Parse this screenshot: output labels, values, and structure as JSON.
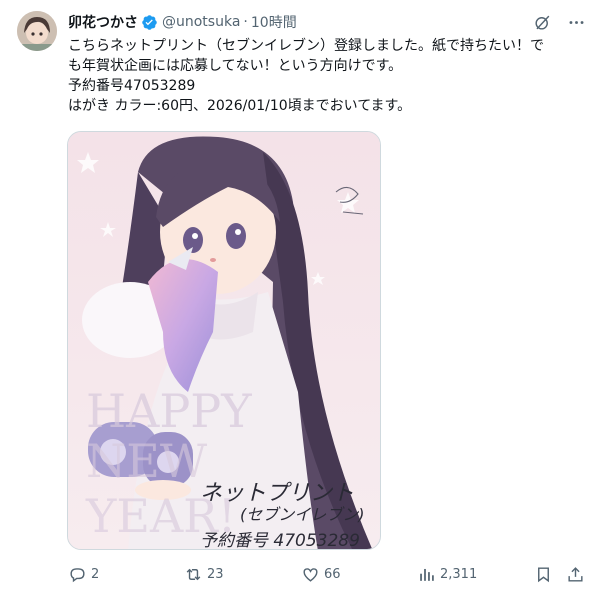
{
  "author": {
    "display_name": "卯花つかさ",
    "handle": "@unotsuka",
    "separator": "·",
    "timestamp": "10時間"
  },
  "post": {
    "lines": [
      "こちらネットプリント（セブンイレブン）登録しました。紙で持ちたい！で",
      "も年賀状企画には応募してない！という方向けです。",
      "予約番号47053289",
      "はがき カラー:60円、2026/01/10頃までおいてます。"
    ]
  },
  "media": {
    "overlay_text": "HAPPY NEW YEAR!",
    "handwritten": [
      "ネットプリント",
      "(セブンイレブン)",
      "予約番号 47053289"
    ],
    "colors": {
      "bg": "#f6e6ea",
      "hair": "#5a4a66",
      "dress": "#f3eef2"
    }
  },
  "actions": {
    "replies": "2",
    "reposts": "23",
    "likes": "66",
    "views": "2,311"
  },
  "icons": [
    "grok-icon",
    "more-icon",
    "reply-icon",
    "repost-icon",
    "like-icon",
    "views-icon",
    "bookmark-icon",
    "share-icon",
    "verified-badge-icon"
  ]
}
